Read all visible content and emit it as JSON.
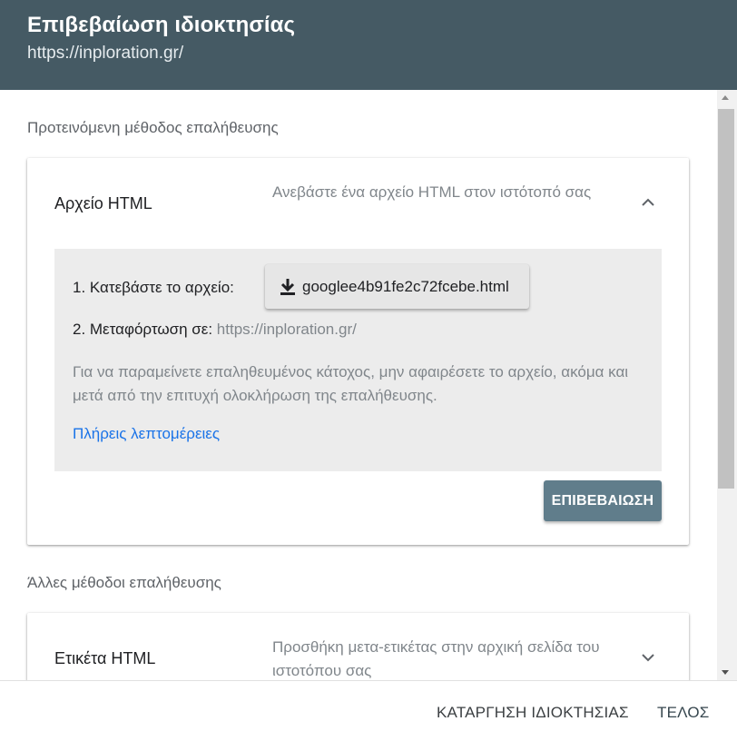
{
  "dialog": {
    "title": "Επιβεβαίωση ιδιοκτησίας",
    "subtitle": "https://inploration.gr/"
  },
  "recommended": {
    "section_label": "Προτεινόμενη μέθοδος επαλήθευσης",
    "method_title": "Αρχείο HTML",
    "method_description": "Ανεβάστε ένα αρχείο HTML στον ιστότοπό σας",
    "expanded": true,
    "step1_label": "1. Κατεβάστε το αρχείο:",
    "download_filename": "googlee4b91fe2c72fcebe.html",
    "step2_label": "2. Μεταφόρτωση σε:",
    "step2_url": "https://inploration.gr/",
    "note": "Για να παραμείνετε επαληθευμένος κάτοχος, μην αφαιρέσετε το αρχείο, ακόμα και μετά από την επιτυχή ολοκλήρωση της επαλήθευσης.",
    "details_link": "Πλήρεις λεπτομέρειες",
    "verify_button": "ΕΠΙΒΕΒΑΙΩΣΗ"
  },
  "other": {
    "section_label": "Άλλες μέθοδοι επαλήθευσης",
    "methods": [
      {
        "title": "Ετικέτα HTML",
        "description": "Προσθήκη μετα-ετικέτας στην αρχική σελίδα του ιστοτόπου σας",
        "expanded": false
      }
    ]
  },
  "footer": {
    "remove_button": "ΚΑΤΑΡΓΗΣΗ ΙΔΙΟΚΤΗΣΙΑΣ",
    "done_button": "ΤΕΛΟΣ"
  },
  "icons": {
    "chevron_up": "chevron-up-icon",
    "chevron_down": "chevron-down-icon",
    "download": "download-icon"
  },
  "colors": {
    "header_bg": "#455a64",
    "verify_button_bg": "#607d8b",
    "link": "#1a73e8"
  }
}
